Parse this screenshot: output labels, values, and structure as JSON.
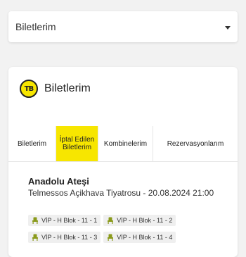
{
  "dropdown": {
    "label": "Biletlerim"
  },
  "card": {
    "title": "Biletlerim",
    "logo_text": "TB",
    "accent_color": "#f7e600"
  },
  "tabs": [
    {
      "label": "Biletlerim",
      "active": false
    },
    {
      "label": "İptal Edilen Biletlerim",
      "active": true
    },
    {
      "label": "Kombinelerim",
      "active": false
    },
    {
      "label": "Rezervasyonlarım",
      "active": false
    }
  ],
  "event": {
    "title": "Anadolu Ateşi",
    "venue_date": "Telmessos Açikhava Tiyatrosu - 20.08.2024 21:00"
  },
  "seats": [
    {
      "label": "VİP - H Blok - 11 - 1",
      "icon": "seat-icon"
    },
    {
      "label": "VİP - H Blok - 11 - 2",
      "icon": "seat-icon"
    },
    {
      "label": "VİP - H Blok - 11 - 3",
      "icon": "seat-icon"
    },
    {
      "label": "VİP - H Blok - 11 - 4",
      "icon": "seat-icon"
    }
  ]
}
